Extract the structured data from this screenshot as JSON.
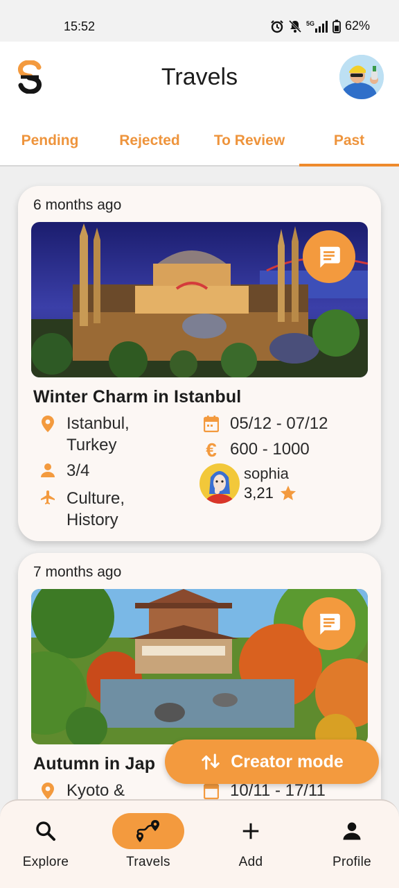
{
  "status_bar": {
    "time": "15:52",
    "battery": "62%",
    "network": "5G"
  },
  "header": {
    "title": "Travels"
  },
  "tabs": [
    {
      "label": "Pending",
      "active": false
    },
    {
      "label": "Rejected",
      "active": false
    },
    {
      "label": "To Review",
      "active": false
    },
    {
      "label": "Past",
      "active": true
    }
  ],
  "trips": [
    {
      "ago": "6 months ago",
      "title": "Winter Charm in Istanbul",
      "location": "Istanbul, Turkey",
      "dates": "05/12 - 07/12",
      "participants": "3/4",
      "price": "600 - 1000",
      "categories": "Culture, History",
      "creator": {
        "name": "sophia",
        "rating": "3,21"
      }
    },
    {
      "ago": "7 months ago",
      "title": "Autumn in Jap",
      "location": "Kyoto &",
      "dates": "10/11 - 17/11"
    }
  ],
  "creator_mode": {
    "label": "Creator mode"
  },
  "bottom_nav": [
    {
      "label": "Explore",
      "icon": "search-icon",
      "active": false
    },
    {
      "label": "Travels",
      "icon": "route-icon",
      "active": true
    },
    {
      "label": "Add",
      "icon": "plus-icon",
      "active": false
    },
    {
      "label": "Profile",
      "icon": "person-icon",
      "active": false
    }
  ],
  "colors": {
    "accent": "#f39a3e",
    "tab_text": "#ee943c",
    "card_bg": "#fcf7f4",
    "page_bg": "#efefef"
  }
}
